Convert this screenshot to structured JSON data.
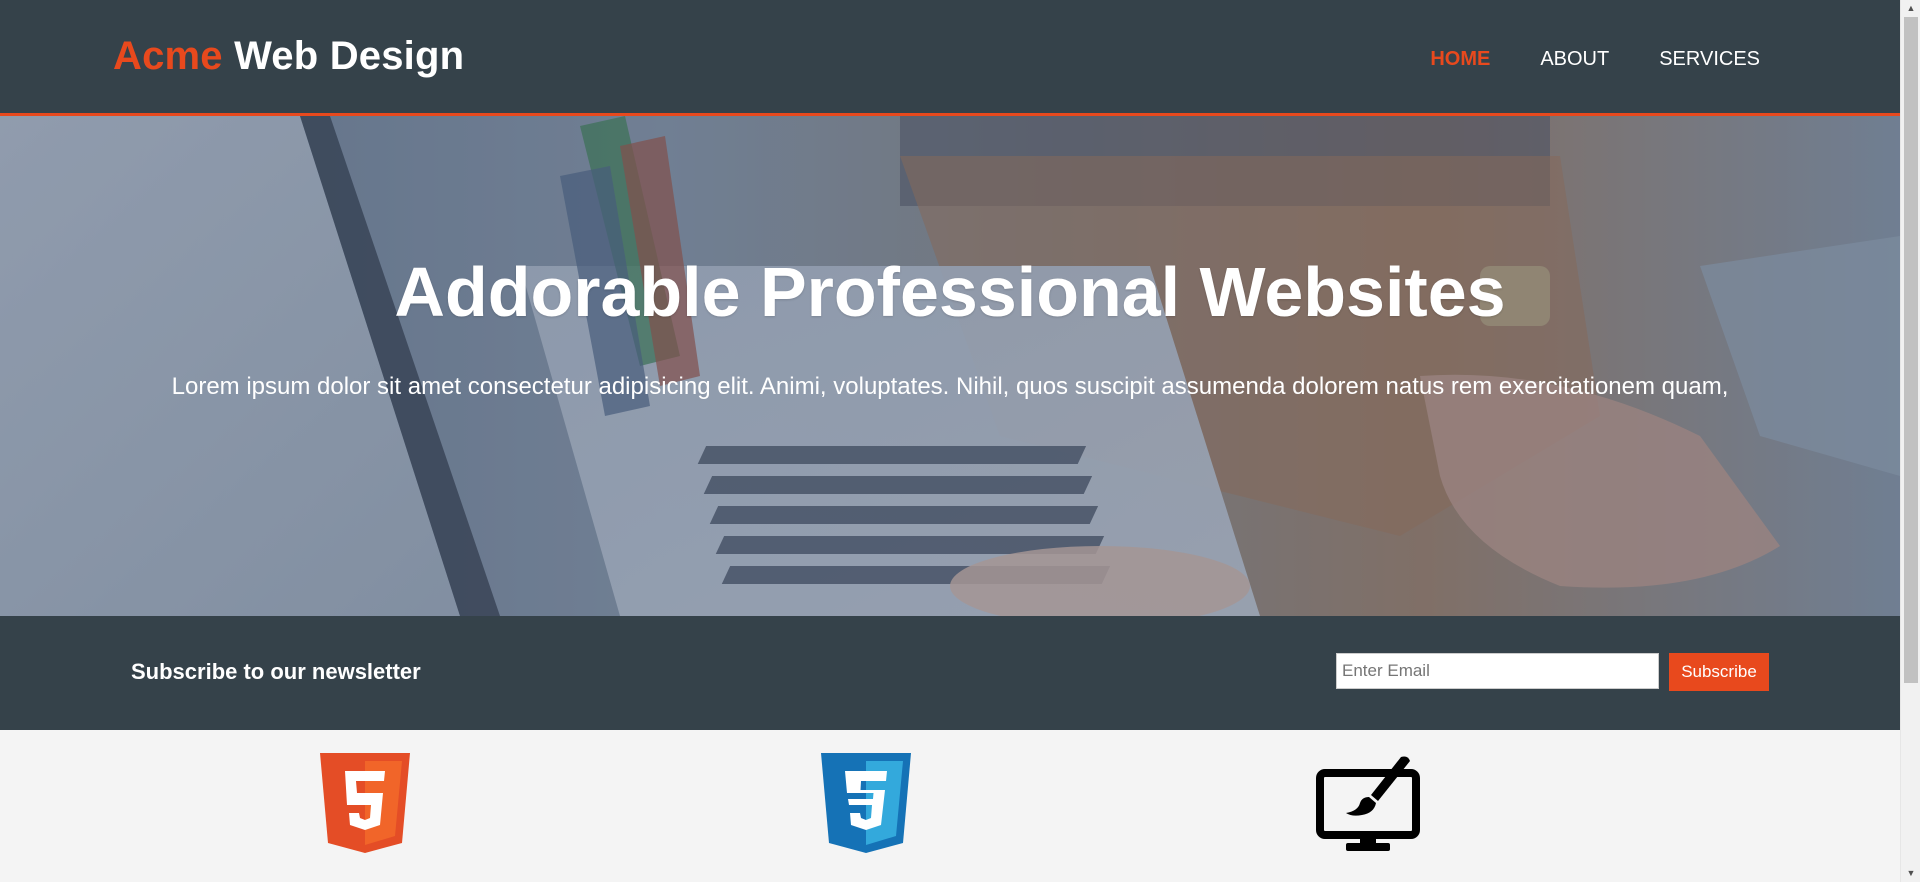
{
  "branding": {
    "highlight": "Acme",
    "rest": "Web Design"
  },
  "nav": {
    "items": [
      {
        "label": "HOME",
        "current": true
      },
      {
        "label": "ABOUT",
        "current": false
      },
      {
        "label": "SERVICES",
        "current": false
      }
    ]
  },
  "showcase": {
    "title": "Addorable Professional Websites",
    "text": "Lorem ipsum dolor sit amet consectetur adipisicing elit. Animi, voluptates. Nihil, quos suscipit assumenda dolorem natus rem exercitationem quam,"
  },
  "newsletter": {
    "title": "Subscribe to our newsletter",
    "email_placeholder": "Enter Email",
    "email_value": "",
    "button_label": "Subscribe"
  },
  "boxes": {
    "icons": [
      "html5-logo-icon",
      "css3-logo-icon",
      "monitor-paintbrush-icon"
    ]
  },
  "colors": {
    "accent": "#e8491d",
    "dark": "#35424a",
    "light": "#f4f4f4",
    "html5_orange": "#e44d26",
    "css3_blue": "#1572b6"
  }
}
